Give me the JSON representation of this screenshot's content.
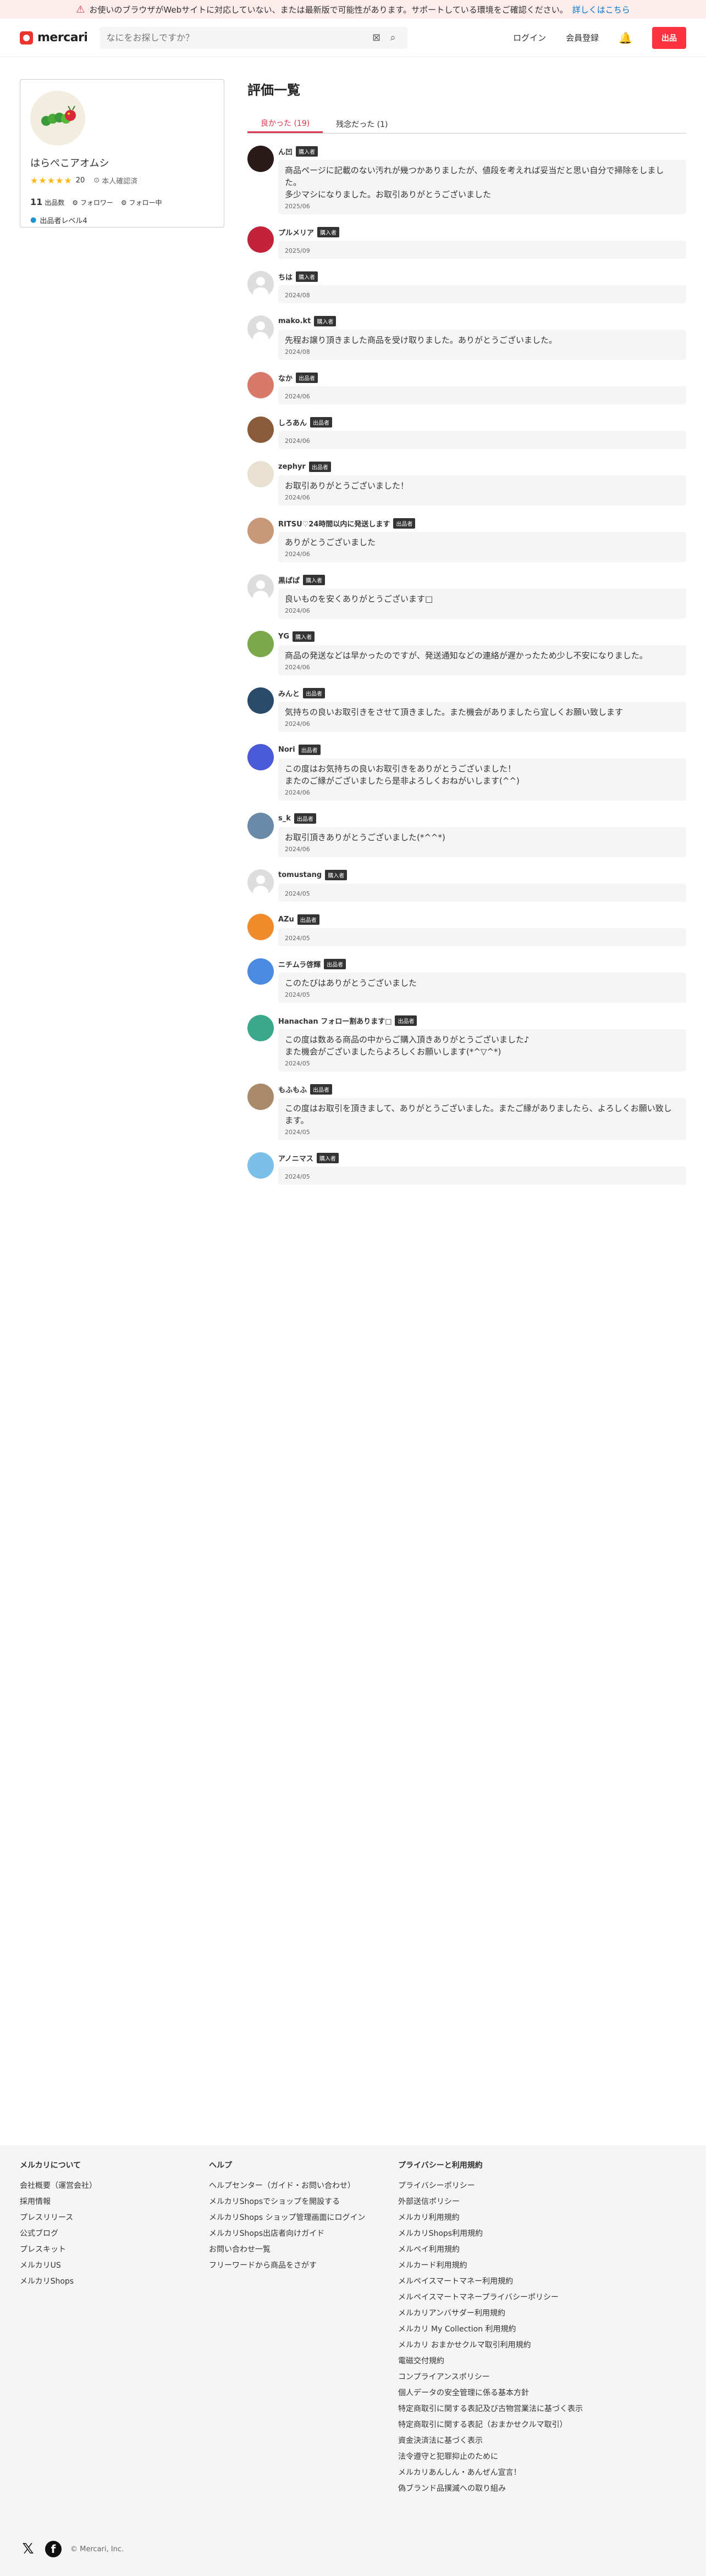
{
  "warning": {
    "text": "お使いのブラウザがWebサイトに対応していない、または最新版で可能性があります。サポートしている環境をご確認ください。",
    "link": "詳しくはこちら"
  },
  "header": {
    "logo": "mercari",
    "search_placeholder": "なにをお探しですか？",
    "login": "ログイン",
    "signup": "会員登録",
    "sell": "出品"
  },
  "profile": {
    "name": "はらぺこアオムシ",
    "stars": "★★★★★",
    "rating_count": "20",
    "verified": "本人確認済",
    "listings_count": "11",
    "listings_label": "出品数",
    "followers_label": "フォロワー",
    "following_label": "フォロー中",
    "seller_level": "出品者レベル4"
  },
  "main": {
    "title": "評価一覧",
    "tab_good": "良かった (19)",
    "tab_bad": "残念だった (1)"
  },
  "reviews": [
    {
      "name": "ん凹",
      "badge": "購入者",
      "text": "商品ページに記載のない汚れが幾つかありましたが、値段を考えれば妥当だと思い自分で掃除をしました。\n多少マシになりました。お取引ありがとうございました",
      "date": "2025/06",
      "color": "#2a1a1a"
    },
    {
      "name": "プルメリア",
      "badge": "購入者",
      "text": "",
      "date": "2025/09",
      "color": "#c4213a"
    },
    {
      "name": "ちは",
      "badge": "購入者",
      "text": "",
      "date": "2024/08",
      "color": "default"
    },
    {
      "name": "mako.kt",
      "badge": "購入者",
      "text": "先程お譲り頂きました商品を受け取りました。ありがとうございました。",
      "date": "2024/08",
      "color": "default"
    },
    {
      "name": "なか",
      "badge": "出品者",
      "text": "",
      "date": "2024/06",
      "color": "#d87a6a"
    },
    {
      "name": "しろあん",
      "badge": "出品者",
      "text": "",
      "date": "2024/06",
      "color": "#8a5a3a"
    },
    {
      "name": "zephyr",
      "badge": "出品者",
      "text": "お取引ありがとうございました！",
      "date": "2024/06",
      "color": "#e8e0d0"
    },
    {
      "name": "RITSU♡24時間以内に発送します",
      "badge": "出品者",
      "text": "ありがとうございました",
      "date": "2024/06",
      "color": "#c89878"
    },
    {
      "name": "黒ぱぱ",
      "badge": "購入者",
      "text": "良いものを安くありがとうございます□",
      "date": "2024/06",
      "color": "default"
    },
    {
      "name": "YG",
      "badge": "購入者",
      "text": "商品の発送などは早かったのですが、発送通知などの連絡が遅かったため少し不安になりました。",
      "date": "2024/06",
      "color": "#7aa84a"
    },
    {
      "name": "みんと",
      "badge": "出品者",
      "text": "気持ちの良いお取引きをさせて頂きました。また機会がありましたら宜しくお願い致します",
      "date": "2024/06",
      "color": "#2a4a6a"
    },
    {
      "name": "Nori",
      "badge": "出品者",
      "text": "この度はお気持ちの良いお取引きをありがとうございました！\nまたのご縁がございましたら是非よろしくおねがいします(^^)",
      "date": "2024/06",
      "color": "#4a5ad8"
    },
    {
      "name": "s_k",
      "badge": "出品者",
      "text": "お取引頂きありがとうございました(*^^*)",
      "date": "2024/06",
      "color": "#6a8aa8"
    },
    {
      "name": "tomustang",
      "badge": "購入者",
      "text": "",
      "date": "2024/05",
      "color": "default"
    },
    {
      "name": "AZu",
      "badge": "出品者",
      "text": "",
      "date": "2024/05",
      "color": "#f08a2a"
    },
    {
      "name": "ニチムラ啓輝",
      "badge": "出品者",
      "text": "このたびはありがとうございました",
      "date": "2024/05",
      "color": "#4a8ae0"
    },
    {
      "name": "Hanachan フォロー割あります□",
      "badge": "出品者",
      "text": "この度は数ある商品の中からご購入頂きありがとうございました♪\nまた機会がございましたらよろしくお願いします(*^▽^*)",
      "date": "2024/05",
      "color": "#3aa88a"
    },
    {
      "name": "もふもふ",
      "badge": "出品者",
      "text": "この度はお取引を頂きまして、ありがとうございました。またご縁がありましたら、よろしくお願い致します。",
      "date": "2024/05",
      "color": "#a88a6a"
    },
    {
      "name": "アノニマス",
      "badge": "購入者",
      "text": "",
      "date": "2024/05",
      "color": "#7ac0e8"
    }
  ],
  "footer": {
    "col1": {
      "title": "メルカリについて",
      "links": [
        "会社概要（運営会社）",
        "採用情報",
        "プレスリリース",
        "公式ブログ",
        "プレスキット",
        "メルカリUS",
        "メルカリShops"
      ]
    },
    "col2": {
      "title": "ヘルプ",
      "links": [
        "ヘルプセンター（ガイド・お問い合わせ）",
        "メルカリShopsでショップを開設する",
        "メルカリShops ショップ管理画面にログイン",
        "メルカリShops出店者向けガイド",
        "お問い合わせ一覧",
        "フリーワードから商品をさがす"
      ]
    },
    "col3": {
      "title": "プライバシーと利用規約",
      "links": [
        "プライバシーポリシー",
        "外部送信ポリシー",
        "メルカリ利用規約",
        "メルカリShops利用規約",
        "メルペイ利用規約",
        "メルカード利用規約",
        "メルペイスマートマネー利用規約",
        "メルペイスマートマネープライバシーポリシー",
        "メルカリアンバサダー利用規約",
        "メルカリ My Collection 利用規約",
        "メルカリ おまかせクルマ取引利用規約",
        "電磁交付規約",
        "コンプライアンスポリシー",
        "個人データの安全管理に係る基本方針",
        "特定商取引に関する表記及び古物営業法に基づく表示",
        "特定商取引に関する表記（おまかせクルマ取引）",
        "資金決済法に基づく表示",
        "法令遵守と犯罪抑止のために",
        "メルカリあんしん・あんぜん宣言！",
        "偽ブランド品撲滅への取り組み"
      ]
    },
    "copyright": "© Mercari, Inc."
  }
}
